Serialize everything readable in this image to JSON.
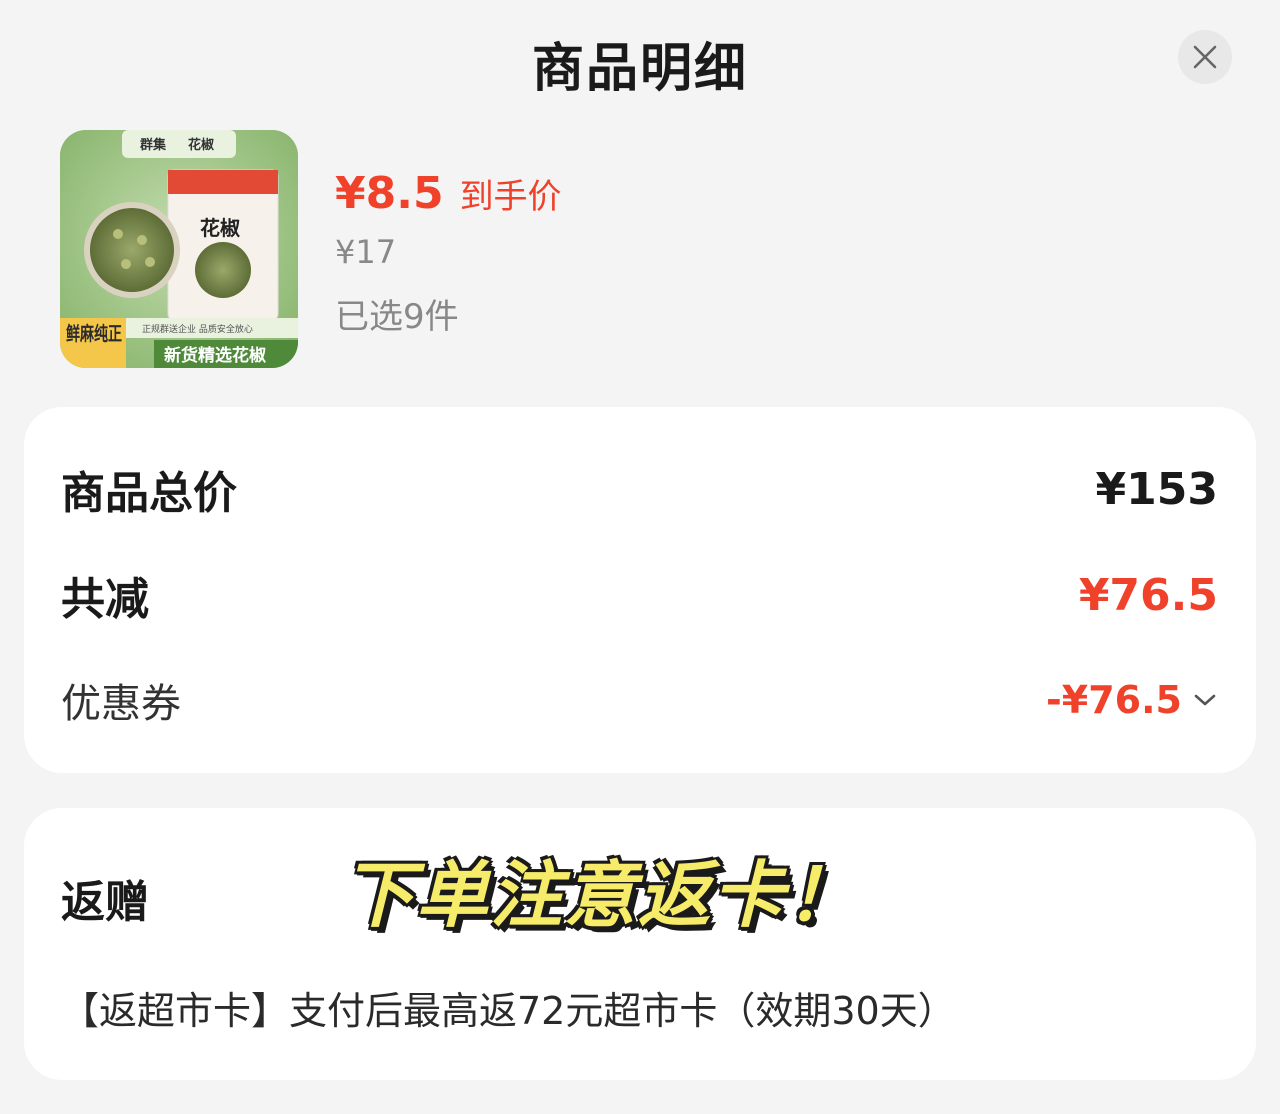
{
  "header": {
    "title": "商品明细"
  },
  "product": {
    "price": "¥8.5",
    "price_label": "到手价",
    "original_price": "¥17",
    "selected": "已选9件",
    "image": {
      "brand": "群集",
      "name": "花椒",
      "tagline": "鲜麻纯正",
      "slogan": "新货精选花椒",
      "subline": "正规群送企业 品质安全放心"
    }
  },
  "summary": {
    "total_label": "商品总价",
    "total_value": "¥153",
    "discount_label": "共减",
    "discount_value": "¥76.5",
    "coupon_label": "优惠券",
    "coupon_value": "-¥76.5"
  },
  "gift": {
    "label": "返赠",
    "stamp": "下单注意返卡！",
    "description": "【返超市卡】支付后最高返72元超市卡（效期30天）"
  },
  "colors": {
    "accent": "#f0422a",
    "background": "#f4f4f4",
    "card": "#ffffff"
  }
}
